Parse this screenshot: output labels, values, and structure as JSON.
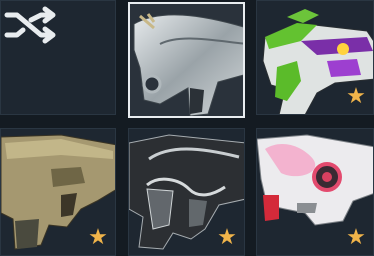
{
  "grid": {
    "tiles": [
      {
        "name": "randomize",
        "icon": "shuffle-icon",
        "selected": false,
        "favorite": false
      },
      {
        "name": "skin-chrome",
        "icon": "weapon-skin-icon",
        "selected": true,
        "favorite": false
      },
      {
        "name": "skin-toy-green-purple",
        "icon": "weapon-skin-icon",
        "selected": false,
        "favorite": true
      },
      {
        "name": "skin-tan-camo",
        "icon": "weapon-skin-icon",
        "selected": false,
        "favorite": true
      },
      {
        "name": "skin-black-glass",
        "icon": "weapon-skin-icon",
        "selected": false,
        "favorite": true
      },
      {
        "name": "skin-white-pink",
        "icon": "weapon-skin-icon",
        "selected": false,
        "favorite": true
      }
    ]
  },
  "colors": {
    "background": "#141b22",
    "tile": "#1e2731",
    "selected_border": "#e9edf0",
    "favorite_star": "#f0b44a"
  }
}
